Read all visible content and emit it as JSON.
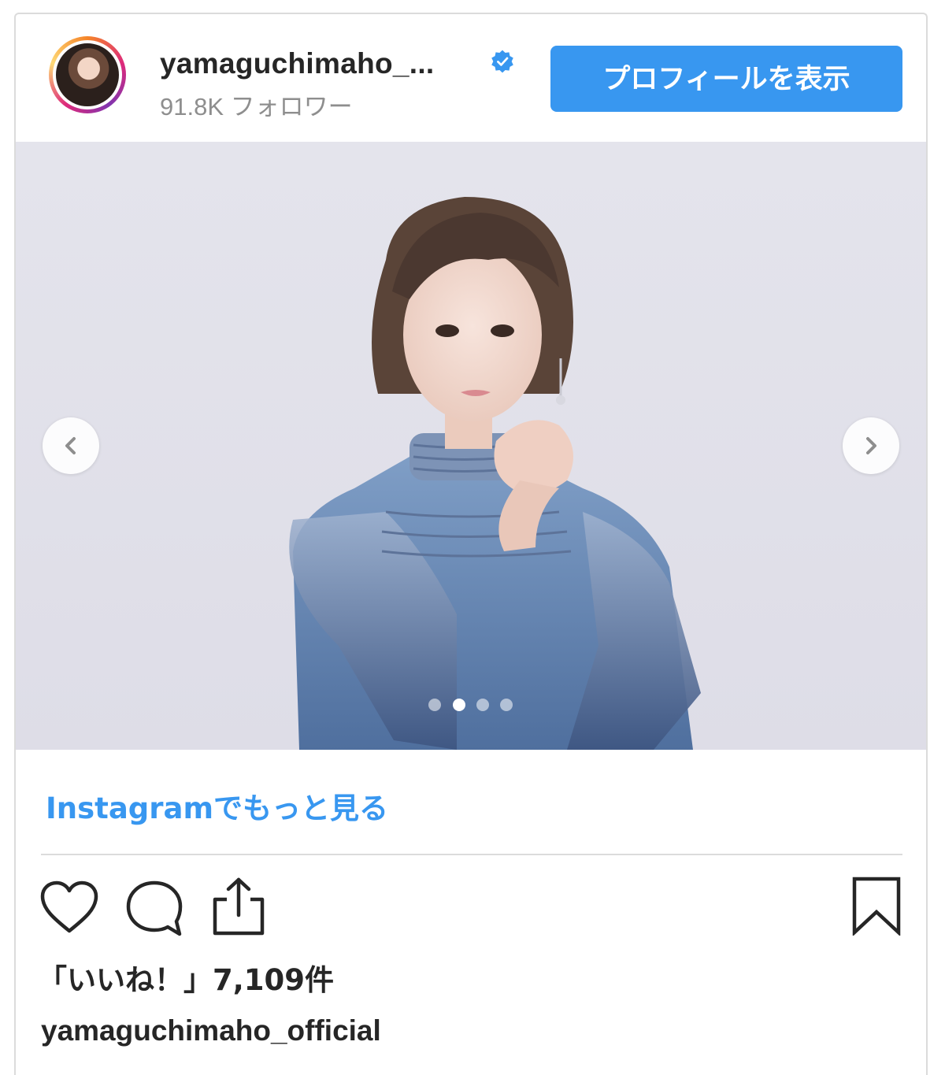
{
  "header": {
    "username": "yamaguchimaho_...",
    "followers": "91.8K フォロワー",
    "profile_button_label": "プロフィールを表示",
    "avatar_icon": "avatar-photo",
    "verified_icon": "verified-badge-icon"
  },
  "post": {
    "photo_alt": "photo",
    "carousel": {
      "slide_count": 4,
      "active_slide": 2,
      "prev_icon": "chevron-left-icon",
      "next_icon": "chevron-right-icon"
    }
  },
  "more_link_label": "Instagramでもっと見る",
  "actions": {
    "like_icon": "heart-icon",
    "comment_icon": "comment-icon",
    "share_icon": "share-icon",
    "save_icon": "bookmark-icon"
  },
  "likes_text": "「いいね！」7,109件",
  "caption_username": "yamaguchimaho_official",
  "colors": {
    "accent": "#3897f0",
    "verified": "#3897f0",
    "text": "#262626",
    "muted": "#8e8e8e"
  }
}
